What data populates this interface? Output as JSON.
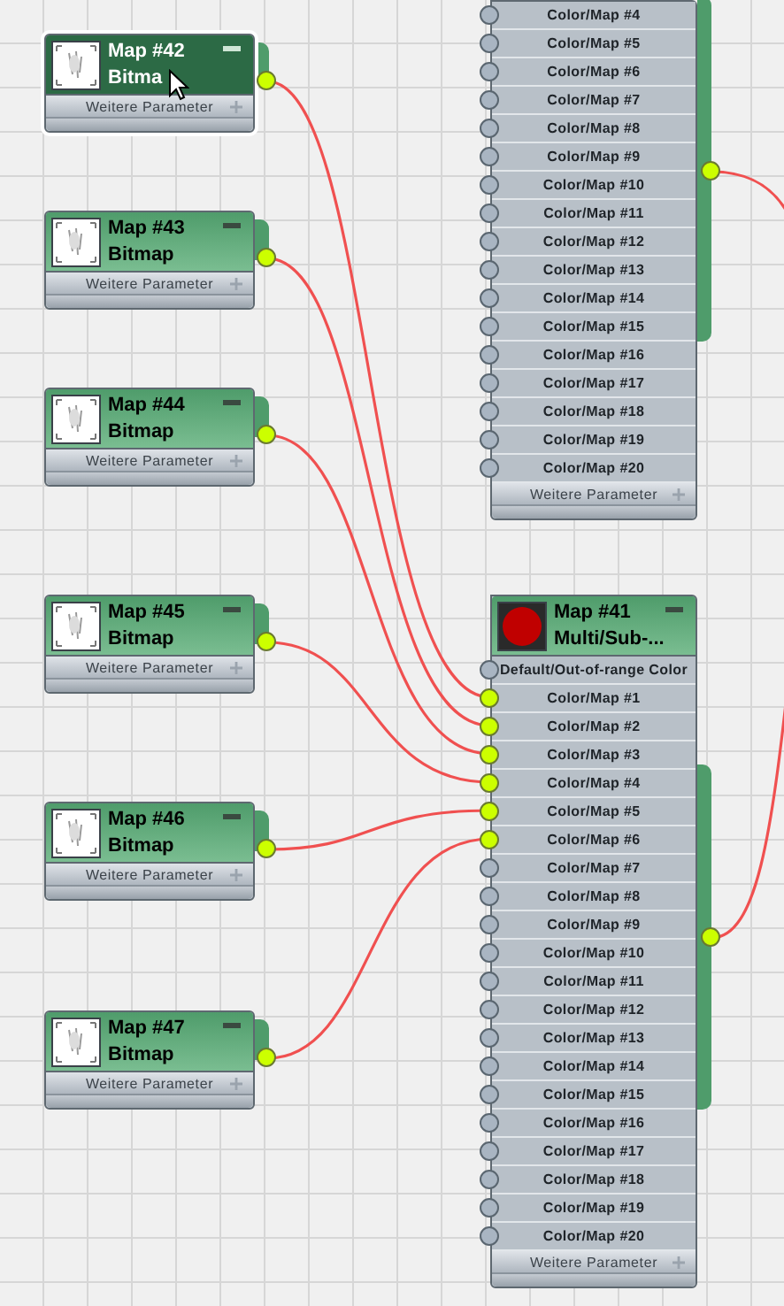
{
  "canvas": {
    "bitmap_nodes": [
      {
        "title": "Map #42",
        "type": "Bitma",
        "selected": true,
        "footer": "Weitere Parameter",
        "wired": true
      },
      {
        "title": "Map #43",
        "type": "Bitmap",
        "selected": false,
        "footer": "Weitere Parameter",
        "wired": true
      },
      {
        "title": "Map #44",
        "type": "Bitmap",
        "selected": false,
        "footer": "Weitere Parameter",
        "wired": true
      },
      {
        "title": "Map #45",
        "type": "Bitmap",
        "selected": false,
        "footer": "Weitere Parameter",
        "wired": true
      },
      {
        "title": "Map #46",
        "type": "Bitmap",
        "selected": false,
        "footer": "Weitere Parameter",
        "wired": true
      },
      {
        "title": "Map #47",
        "type": "Bitmap",
        "selected": false,
        "footer": "Weitere Parameter",
        "wired": true
      }
    ],
    "multi_nodes": [
      {
        "footer": "Weitere Parameter",
        "output_wired": true,
        "slots": [
          {
            "label": "Color/Map #4",
            "connected": false
          },
          {
            "label": "Color/Map #5",
            "connected": false
          },
          {
            "label": "Color/Map #6",
            "connected": false
          },
          {
            "label": "Color/Map #7",
            "connected": false
          },
          {
            "label": "Color/Map #8",
            "connected": false
          },
          {
            "label": "Color/Map #9",
            "connected": false
          },
          {
            "label": "Color/Map #10",
            "connected": false
          },
          {
            "label": "Color/Map #11",
            "connected": false
          },
          {
            "label": "Color/Map #12",
            "connected": false
          },
          {
            "label": "Color/Map #13",
            "connected": false
          },
          {
            "label": "Color/Map #14",
            "connected": false
          },
          {
            "label": "Color/Map #15",
            "connected": false
          },
          {
            "label": "Color/Map #16",
            "connected": false
          },
          {
            "label": "Color/Map #17",
            "connected": false
          },
          {
            "label": "Color/Map #18",
            "connected": false
          },
          {
            "label": "Color/Map #19",
            "connected": false
          },
          {
            "label": "Color/Map #20",
            "connected": false
          }
        ]
      },
      {
        "title": "Map #41",
        "type": "Multi/Sub-...",
        "footer": "Weitere Parameter",
        "output_wired": true,
        "slots": [
          {
            "label": "Default/Out-of-range Color",
            "connected": false
          },
          {
            "label": "Color/Map #1",
            "connected": true
          },
          {
            "label": "Color/Map #2",
            "connected": true
          },
          {
            "label": "Color/Map #3",
            "connected": true
          },
          {
            "label": "Color/Map #4",
            "connected": true
          },
          {
            "label": "Color/Map #5",
            "connected": true
          },
          {
            "label": "Color/Map #6",
            "connected": true
          },
          {
            "label": "Color/Map #7",
            "connected": false
          },
          {
            "label": "Color/Map #8",
            "connected": false
          },
          {
            "label": "Color/Map #9",
            "connected": false
          },
          {
            "label": "Color/Map #10",
            "connected": false
          },
          {
            "label": "Color/Map #11",
            "connected": false
          },
          {
            "label": "Color/Map #12",
            "connected": false
          },
          {
            "label": "Color/Map #13",
            "connected": false
          },
          {
            "label": "Color/Map #14",
            "connected": false
          },
          {
            "label": "Color/Map #15",
            "connected": false
          },
          {
            "label": "Color/Map #16",
            "connected": false
          },
          {
            "label": "Color/Map #17",
            "connected": false
          },
          {
            "label": "Color/Map #18",
            "connected": false
          },
          {
            "label": "Color/Map #19",
            "connected": false
          },
          {
            "label": "Color/Map #20",
            "connected": false
          }
        ]
      }
    ]
  }
}
